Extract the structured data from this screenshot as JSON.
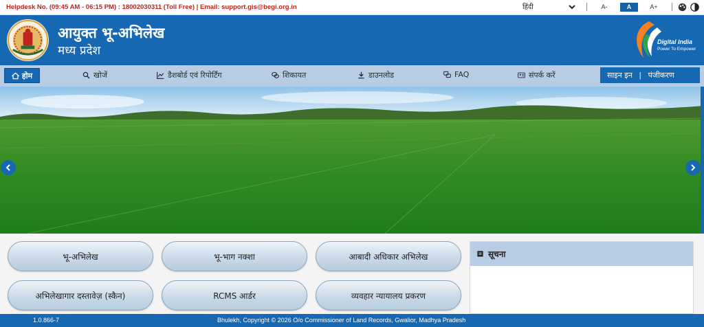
{
  "topbar": {
    "helpdesk": "Helpdesk No. (09:45 AM - 06:15 PM) : 18002030311 (Toll Free) | Email: support.gis@begi.org.in",
    "language": "हिंदी",
    "font_decrease": "A-",
    "font_normal": "A",
    "font_increase": "A+"
  },
  "header": {
    "title": "आयुक्त भू-अभिलेख",
    "subtitle": "मध्य प्रदेश",
    "digital_india": "Digital India",
    "digital_india_tagline": "Power To Empower"
  },
  "nav": {
    "home": "होम",
    "search": "खोजें",
    "dashboard": "डैशबोर्ड एवं रिपोर्टिंग",
    "complaint": "शिकायत",
    "download": "डाउनलोड",
    "faq": "FAQ",
    "contact": "संपर्क करें",
    "signin": "साइन इन",
    "register": "पंजीकरण"
  },
  "services": [
    "भू-अभिलेख",
    "भू-भाग नक्शा",
    "आबादी अधिकार अभिलेख",
    "अभिलेखागार दस्तावेज़ (स्कैन)",
    "RCMS आर्डर",
    "व्यवहार न्यायालय प्रकरण"
  ],
  "notice": {
    "title": "सूचना"
  },
  "footer": {
    "version": "1.0.866-7",
    "copyright": "Bhulekh, Copyright © 2026 O/o Commissioner of Land Records, Gwalior, Madhya Pradesh"
  },
  "colors": {
    "primary": "#1768b3",
    "nav_bg": "#b8cce4",
    "helpdesk": "#c0241c"
  }
}
